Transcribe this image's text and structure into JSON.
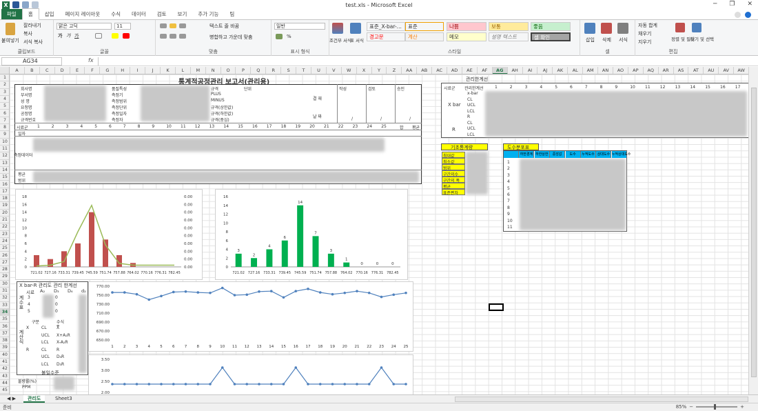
{
  "window": {
    "title": "test.xls  -  Microsoft Excel",
    "controls": [
      "─",
      "❐",
      "✕"
    ]
  },
  "ribbon_tabs": [
    "파일",
    "홈",
    "삽입",
    "페이지 레이아웃",
    "수식",
    "데이터",
    "검토",
    "보기",
    "추가 기능",
    "팀"
  ],
  "ribbon": {
    "clipboard": {
      "label": "클립보드",
      "paste": "붙여넣기",
      "cut": "잘라내기",
      "copy": "복사",
      "format_painter": "서식 복사"
    },
    "font": {
      "label": "글꼴",
      "font_name": "맑은 고딕",
      "font_size": "11"
    },
    "alignment": {
      "label": "맞춤",
      "wrap": "텍스트 줄 바꿈",
      "merge": "병합하고 가운데 맞춤"
    },
    "number": {
      "label": "표시 형식",
      "format": "일반"
    },
    "styles": {
      "label": "스타일",
      "conditional": "조건부 서식",
      "table": "표 서식",
      "cell_styles": [
        {
          "text": "표준_X-bar-...",
          "bg": "#ffffff",
          "color": "#333333"
        },
        {
          "text": "표준",
          "bg": "#ffffff",
          "color": "#333333"
        },
        {
          "text": "나쁨",
          "bg": "#ffc7ce",
          "color": "#9c0006"
        },
        {
          "text": "보통",
          "bg": "#ffeb9c",
          "color": "#9c6500"
        },
        {
          "text": "좋음",
          "bg": "#c6efce",
          "color": "#006100"
        },
        {
          "text": "경고문",
          "bg": "#ffffff",
          "color": "#ff0000"
        },
        {
          "text": "계산",
          "bg": "#f2f2f2",
          "color": "#fa7d00"
        },
        {
          "text": "메모",
          "bg": "#ffffcc",
          "color": "#333333"
        },
        {
          "text": "설명 텍스트",
          "bg": "#ffffff",
          "color": "#7f7f7f"
        },
        {
          "text": "셀 확인",
          "bg": "#a5a5a5",
          "color": "#ffffff"
        }
      ]
    },
    "cells": {
      "label": "셀",
      "insert": "삽입",
      "delete": "삭제",
      "format": "서식"
    },
    "editing": {
      "label": "편집",
      "autosum": "자동 합계",
      "fill": "채우기",
      "clear": "지우기",
      "sort": "정렬 및 필터",
      "find": "찾기 및 선택"
    }
  },
  "formula_bar": {
    "name_box": "AG34",
    "fx": "fx",
    "value": ""
  },
  "columns": [
    "A",
    "B",
    "C",
    "D",
    "E",
    "F",
    "G",
    "H",
    "I",
    "J",
    "K",
    "L",
    "M",
    "N",
    "O",
    "P",
    "Q",
    "R",
    "S",
    "T",
    "U",
    "V",
    "W",
    "X",
    "Y",
    "Z",
    "AA",
    "AB",
    "AC",
    "AD",
    "AE",
    "AF",
    "AG",
    "AH",
    "AI",
    "AJ",
    "AK",
    "AL",
    "AM",
    "AN",
    "AO",
    "AP",
    "AQ",
    "AR",
    "AS",
    "AT",
    "AU",
    "AV",
    "AW"
  ],
  "selected_column": "AG",
  "rows": [
    "1",
    "2",
    "3",
    "4",
    "5",
    "6",
    "7",
    "8",
    "9",
    "10",
    "11",
    "12",
    "13",
    "14",
    "15",
    "16",
    "17",
    "18",
    "19",
    "20",
    "21",
    "22",
    "23",
    "24",
    "25",
    "26",
    "27",
    "28",
    "29",
    "30",
    "31",
    "32",
    "33",
    "34",
    "35",
    "36",
    "37",
    "38",
    "39",
    "40",
    "41",
    "42",
    "43",
    "44",
    "45"
  ],
  "selected_row": "34",
  "report": {
    "title": "통계적공정관리 보고서(관리용)",
    "left_labels": [
      "회사명",
      "부서명",
      "성 명",
      "요청명",
      "공정명",
      "규격번호"
    ],
    "mid_labels": [
      "품질특성",
      "측정기",
      "측정범위",
      "측정단위",
      "측정일자",
      "측정자"
    ],
    "spec_labels": [
      "규격",
      "PLUS",
      "MINUS",
      "규격(상한값)",
      "규격(하한값)",
      "규격(중심)"
    ],
    "spec_col": "단위",
    "approval": [
      "작성",
      "검토",
      "승인"
    ],
    "approval_side": "결 재",
    "date_label": "날 짜",
    "date_sep": "/",
    "sample_label": "시료군",
    "date_row": "일자",
    "meas_label": "측정데이터",
    "sample_numbers": [
      "1",
      "2",
      "3",
      "4",
      "5",
      "6",
      "7",
      "8",
      "9",
      "10",
      "11",
      "12",
      "13",
      "14",
      "15",
      "16",
      "17",
      "18",
      "19",
      "20",
      "21",
      "22",
      "23",
      "24",
      "25"
    ],
    "sum_label": "합",
    "avg_label": "평균",
    "avg_row": "평균",
    "range_row": "범위"
  },
  "control_limits": {
    "title": "관리한계선",
    "sample_group": "시료군",
    "control_line": "관리한계선",
    "xbar": "X bar",
    "r": "R",
    "rows": [
      "x-bar",
      "CL",
      "UCL",
      "LCL",
      "R",
      "CL",
      "UCL",
      "LCL"
    ],
    "numbers": [
      "1",
      "2",
      "3",
      "4",
      "5",
      "6",
      "7",
      "8",
      "9",
      "10",
      "11",
      "12",
      "13",
      "14",
      "15",
      "16",
      "17"
    ]
  },
  "basic_stats": {
    "title": "기초통계량",
    "rows": [
      "최대값",
      "최소값",
      "범위",
      "구간의수",
      "구간의 폭",
      "평균",
      "표준편차"
    ]
  },
  "freq_table": {
    "title": "도수분포표",
    "headers": [
      "",
      "하한경계",
      "하한상한",
      "중앙값",
      "도수",
      "누적도수",
      "상대도수",
      "누적상대도수"
    ],
    "rows": [
      "1",
      "2",
      "3",
      "4",
      "5",
      "6",
      "7",
      "8",
      "9",
      "10",
      "11"
    ]
  },
  "xbar_factors": {
    "title": "X bar-R 관리도 관리 한계선",
    "headers": [
      "시료",
      "A₂",
      "D₃",
      "D₄",
      "d₂"
    ],
    "side": "계수표",
    "rows": [
      [
        "3",
        "",
        "0",
        ""
      ],
      [
        "4",
        "",
        "0",
        ""
      ],
      [
        "5",
        "",
        "0",
        ""
      ]
    ],
    "calc_side": "계산식",
    "calc_headers": [
      "구분",
      "수식"
    ],
    "calc_rows": [
      [
        "X",
        "CL",
        "X̿"
      ],
      [
        "",
        "UCL",
        "X+A₂R"
      ],
      [
        "",
        "LCL",
        "X-A₂R"
      ],
      [
        "R",
        "CL",
        "R"
      ],
      [
        "",
        "UCL",
        "D₄R"
      ],
      [
        "",
        "LCL",
        "D₃R"
      ]
    ]
  },
  "defect": {
    "title": "불일수준",
    "rate": "불량률(%)",
    "ppm": "PPM"
  },
  "charts": [
    {
      "type": "bar",
      "title": "",
      "categories": [
        "721.02",
        "727.16",
        "733.31",
        "739.45",
        "745.59",
        "751.74",
        "757.88",
        "764.02",
        "770.16",
        "776.31",
        "782.45"
      ],
      "values": [
        3,
        2,
        4,
        6,
        14,
        7,
        3,
        1,
        0,
        0,
        0
      ],
      "series": [
        {
          "values": [
            3,
            2,
            4,
            6,
            14,
            7,
            3,
            1,
            0,
            0,
            0
          ],
          "color": "#c0504d"
        }
      ],
      "overlay_line": {
        "color": "#9bbb59",
        "values": [
          0.001,
          0.002,
          0.006,
          0.04,
          0.07,
          0.025,
          0.004,
          0.002,
          0.002,
          0.002,
          0.002
        ]
      },
      "ylim": [
        0,
        18
      ],
      "yticks": [
        "0",
        "2",
        "4",
        "6",
        "8",
        "10",
        "12",
        "14",
        "16",
        "18"
      ],
      "y2ticks": [
        "0.00",
        "0.00",
        "0.00",
        "0.00",
        "0.00",
        "0.00",
        "0.00",
        "0.00",
        "0.00",
        "0.00"
      ],
      "grid": false
    },
    {
      "type": "bar",
      "title": "",
      "categories": [
        "721.02",
        "727.16",
        "733.31",
        "739.45",
        "745.59",
        "751.74",
        "757.88",
        "764.02",
        "770.16",
        "776.31",
        "782.45"
      ],
      "series": [
        {
          "values": [
            3,
            2,
            4,
            6,
            14,
            7,
            3,
            1,
            0,
            0,
            0
          ],
          "color": "#00b050"
        }
      ],
      "data_labels": [
        "3",
        "2",
        "4",
        "6",
        "14",
        "7",
        "3",
        "1",
        "0",
        "0",
        "0"
      ],
      "ylim": [
        0,
        16
      ],
      "yticks": [
        "0",
        "2",
        "4",
        "6",
        "8",
        "10",
        "12",
        "14",
        "16"
      ],
      "grid": false
    },
    {
      "type": "line",
      "title": "",
      "x": [
        "1",
        "2",
        "3",
        "4",
        "5",
        "6",
        "7",
        "8",
        "9",
        "10",
        "11",
        "12",
        "13",
        "14",
        "15",
        "16",
        "17",
        "18",
        "19",
        "20",
        "21",
        "22",
        "23",
        "24",
        "25"
      ],
      "series": [
        {
          "values": [
            756,
            756,
            752,
            740,
            748,
            757,
            758,
            756,
            755,
            766,
            750,
            751,
            758,
            759,
            745,
            759,
            764,
            756,
            752,
            755,
            759,
            755,
            746,
            751,
            755
          ],
          "color": "#4f81bd"
        }
      ],
      "ylim": [
        650,
        770
      ],
      "yticks": [
        "650.00",
        "670.00",
        "690.00",
        "710.00",
        "730.00",
        "750.00",
        "770.00"
      ],
      "grid": false
    },
    {
      "type": "line",
      "title": "",
      "series": [
        {
          "values": [
            2,
            2,
            2,
            2,
            2,
            2,
            2,
            2,
            2,
            3,
            2,
            2,
            2,
            2,
            2,
            3,
            2,
            2,
            2,
            2,
            2,
            2,
            3,
            2,
            2
          ],
          "color": "#4f81bd"
        }
      ],
      "ylim": [
        1.5,
        3.5
      ],
      "yticks": [
        "2.00",
        "2.50",
        "3.00",
        "3.50"
      ],
      "grid": false
    }
  ],
  "sheet_tabs": [
    "관리도",
    "Sheet3"
  ],
  "status": {
    "ready": "준비",
    "zoom": "85%"
  }
}
